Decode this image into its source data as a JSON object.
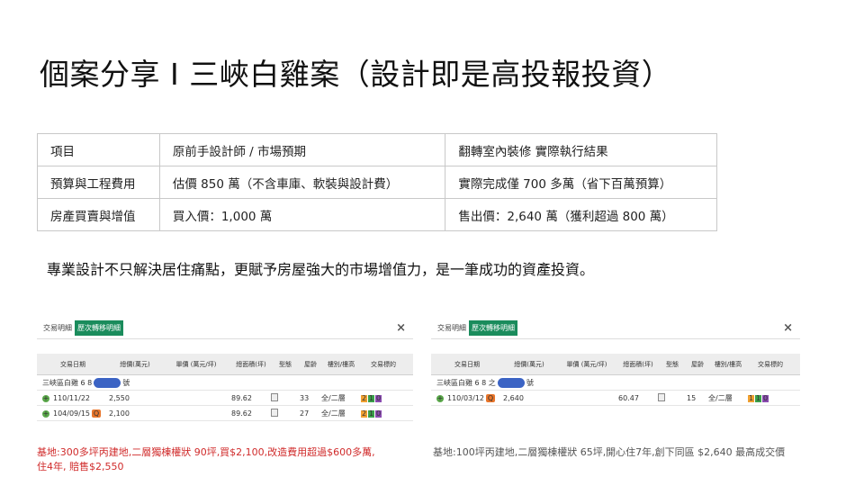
{
  "title": "個案分享 I 三峽白雞案（設計即是高投報投資）",
  "table": {
    "headers": [
      "項目",
      "原前手設計師 / 市場預期",
      "翻轉室內裝修 實際執行結果"
    ],
    "rows": [
      [
        "預算與工程費用",
        "估價 850 萬（不含車庫、軟裝與設計費）",
        "實際完成僅 700 多萬（省下百萬預算）"
      ],
      [
        "房產買賣與增值",
        "買入價：1,000 萬",
        "售出價：2,640 萬（獲利超過 800 萬）"
      ]
    ]
  },
  "summary": "專業設計不只解決居住痛點，更賦予房屋強大的市場增值力，是一筆成功的資產投資。",
  "left_panel": {
    "tabs": [
      "交易明細",
      "歷次轉移明細"
    ],
    "close": "×",
    "columns": [
      "交易日期",
      "總價(萬元)",
      "單價 (萬元/坪)",
      "總面積(坪)",
      "型態",
      "屋齡",
      "樓別/樓高",
      "交易標的"
    ],
    "address_prefix": "三峽區白雞 6 8",
    "address_suffix": "號",
    "rows": [
      {
        "date": "110/11/22",
        "total": "2,550",
        "area": "89.62",
        "age": "33",
        "floor": "全/二層",
        "t1": "2",
        "t2": "1",
        "t3": "0"
      },
      {
        "date": "104/09/15",
        "total": "2,100",
        "area": "89.62",
        "age": "27",
        "floor": "全/二層",
        "t1": "2",
        "t2": "1",
        "t3": "0"
      }
    ],
    "caption": "基地:300多坪丙建地,二層獨棟權狀 90坪,買$2,100,改造費用超過$600多萬, 住4年, 賠售$2,550"
  },
  "right_panel": {
    "tabs": [
      "交易明細",
      "歷次轉移明細"
    ],
    "close": "×",
    "columns": [
      "交易日期",
      "總價(萬元)",
      "單價 (萬元/坪)",
      "總面積(坪)",
      "型態",
      "屋齡",
      "樓別/樓高",
      "交易標的"
    ],
    "address_prefix": "三峽區白雞 6 8 之",
    "address_suffix": "號",
    "rows": [
      {
        "date": "110/03/12",
        "total": "2,640",
        "area": "60.47",
        "age": "15",
        "floor": "全/二層",
        "t1": "1",
        "t2": "1",
        "t3": "0"
      }
    ],
    "caption": "基地:100坪丙建地,二層獨棟權狀 65坪,開心住7年,創下同區 $2,640 最高成交價"
  },
  "colors": {
    "tab_active": "#1a8c5c",
    "left_caption": "#d02b2b",
    "mask": "#3b63c4"
  }
}
